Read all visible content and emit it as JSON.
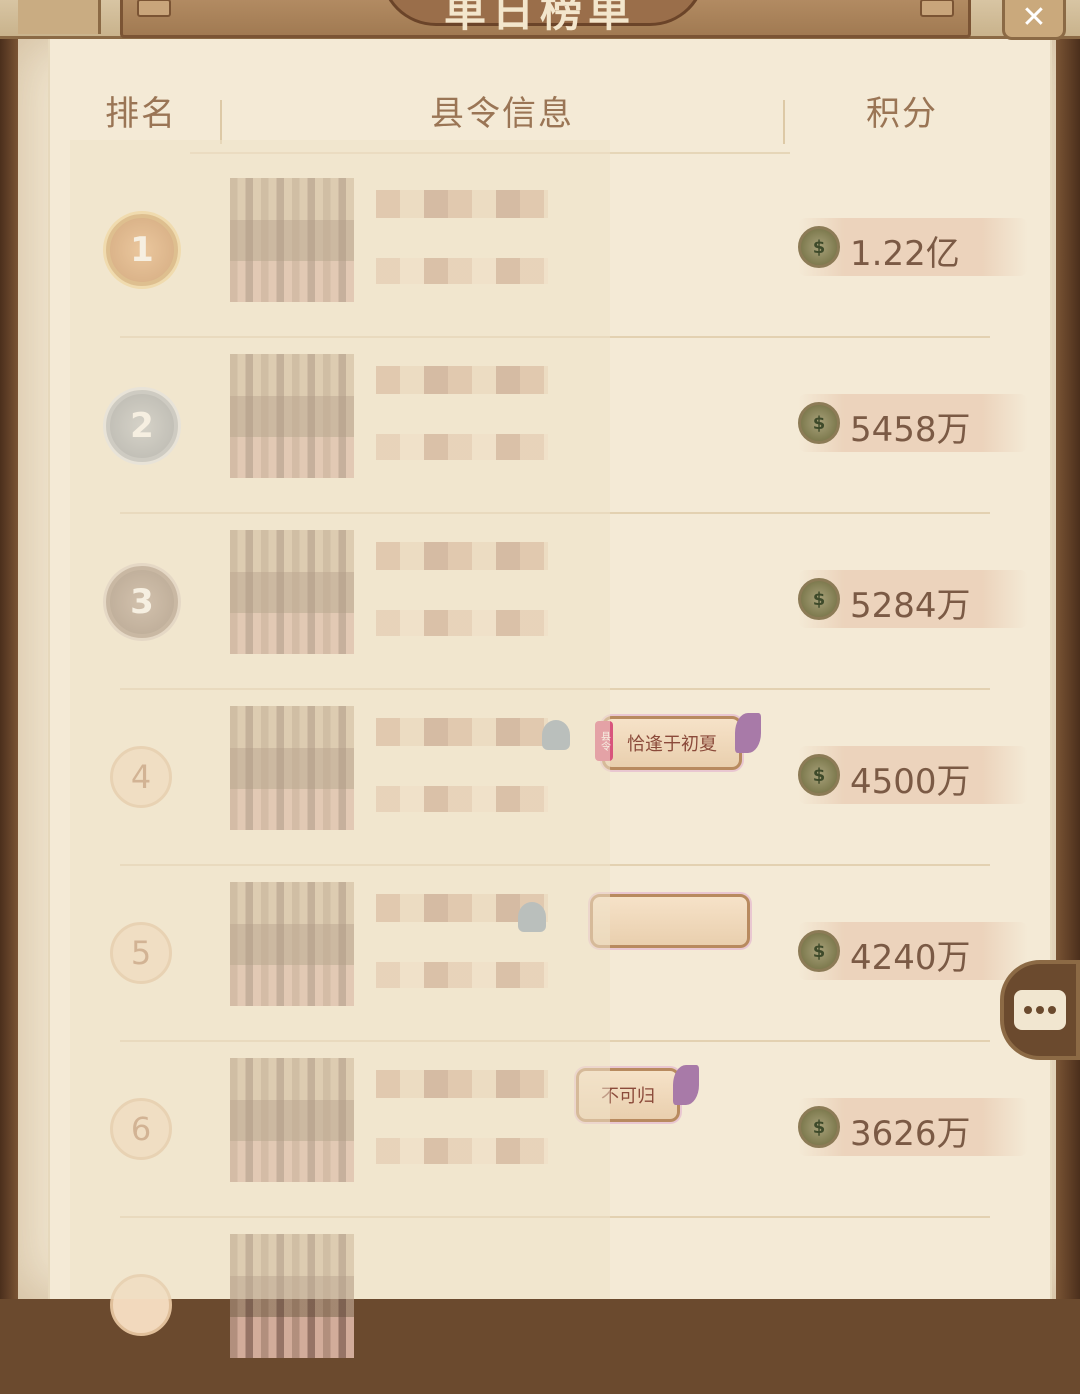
{
  "page": {
    "title": "单日榜单"
  },
  "header": {
    "rank_label": "排名",
    "info_label": "县令信息",
    "score_label": "积分"
  },
  "rows": [
    {
      "rank": "1",
      "score": "1.22亿",
      "tag": ""
    },
    {
      "rank": "2",
      "score": "5458万",
      "tag": ""
    },
    {
      "rank": "3",
      "score": "5284万",
      "tag": ""
    },
    {
      "rank": "4",
      "score": "4500万",
      "tag": "恰逢于初夏",
      "tag_prefix": "县令"
    },
    {
      "rank": "5",
      "score": "4240万",
      "tag": ""
    },
    {
      "rank": "6",
      "score": "3626万",
      "tag": "不可归"
    }
  ],
  "coin_glyph": "$",
  "close_glyph": "✕",
  "colors": {
    "paper": "#f4ead6",
    "frame": "#6b4a2e",
    "score_text": "#7b5a45"
  }
}
